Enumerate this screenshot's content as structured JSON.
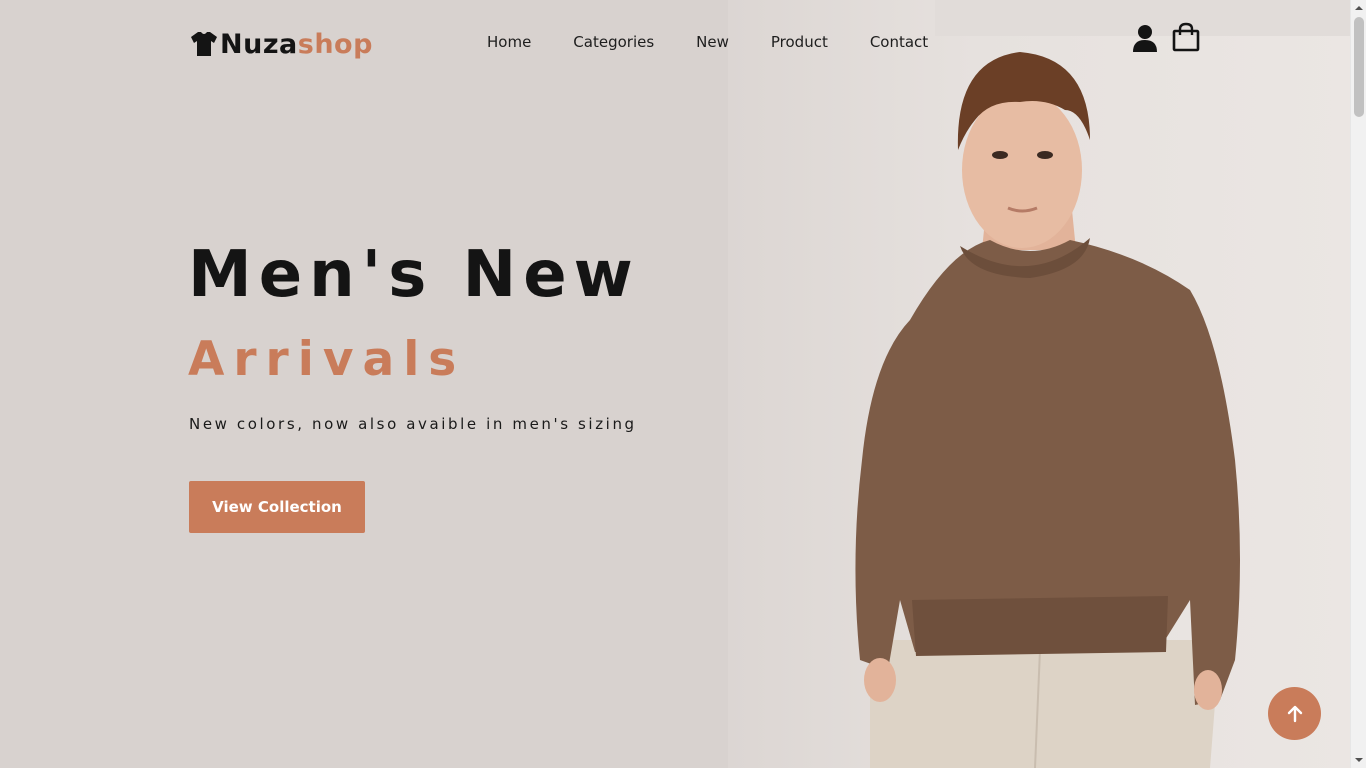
{
  "brand": {
    "name_main": "Nuza",
    "name_accent": "shop"
  },
  "nav": {
    "items": [
      "Home",
      "Categories",
      "New",
      "Product",
      "Contact"
    ]
  },
  "header_icons": {
    "user": "user-icon",
    "bag": "shopping-bag-icon"
  },
  "hero": {
    "title_line1": "Men's New",
    "title_line2": "Arrivals",
    "subtitle": "New colors, now also avaible in men's sizing",
    "cta_label": "View Collection"
  },
  "scroll_top_icon": "arrow-up-icon",
  "colors": {
    "accent": "#c97c5a",
    "background": "#d8d2cf",
    "text": "#141414"
  }
}
